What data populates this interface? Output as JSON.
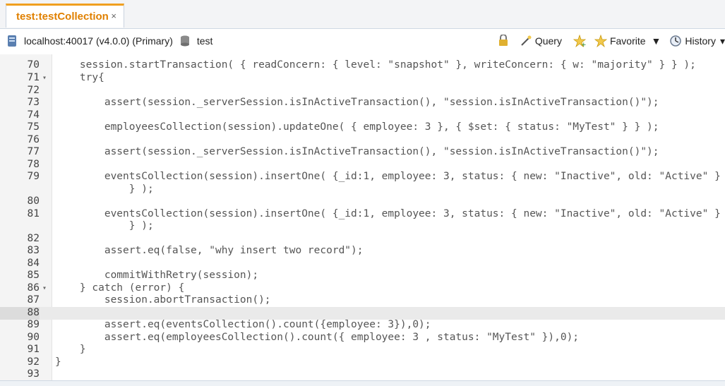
{
  "tab": {
    "title": "test:testCollection",
    "close": "×"
  },
  "toolbar": {
    "connection": "localhost:40017 (v4.0.0) (Primary)",
    "database": "test",
    "query_label": "Query",
    "favorite_label": "Favorite",
    "history_label": "History"
  },
  "editor": {
    "highlighted_line": "88",
    "lines": [
      {
        "n": "70",
        "fold": "",
        "code": "    session.startTransaction( { readConcern: { level: \"snapshot\" }, writeConcern: { w: \"majority\" } } );"
      },
      {
        "n": "71",
        "fold": "▾",
        "code": "    try{"
      },
      {
        "n": "72",
        "fold": "",
        "code": ""
      },
      {
        "n": "73",
        "fold": "",
        "code": "        assert(session._serverSession.isInActiveTransaction(), \"session.isInActiveTransaction()\");"
      },
      {
        "n": "74",
        "fold": "",
        "code": ""
      },
      {
        "n": "75",
        "fold": "",
        "code": "        employeesCollection(session).updateOne( { employee: 3 }, { $set: { status: \"MyTest\" } } );"
      },
      {
        "n": "76",
        "fold": "",
        "code": ""
      },
      {
        "n": "77",
        "fold": "",
        "code": "        assert(session._serverSession.isInActiveTransaction(), \"session.isInActiveTransaction()\");"
      },
      {
        "n": "78",
        "fold": "",
        "code": ""
      },
      {
        "n": "79",
        "fold": "",
        "code": "        eventsCollection(session).insertOne( {_id:1, employee: 3, status: { new: \"Inactive\", old: \"Active\" }"
      },
      {
        "n": "",
        "fold": "",
        "code": "            } );"
      },
      {
        "n": "80",
        "fold": "",
        "code": ""
      },
      {
        "n": "81",
        "fold": "",
        "code": "        eventsCollection(session).insertOne( {_id:1, employee: 3, status: { new: \"Inactive\", old: \"Active\" }"
      },
      {
        "n": "",
        "fold": "",
        "code": "            } );"
      },
      {
        "n": "82",
        "fold": "",
        "code": ""
      },
      {
        "n": "83",
        "fold": "",
        "code": "        assert.eq(false, \"why insert two record\");"
      },
      {
        "n": "84",
        "fold": "",
        "code": ""
      },
      {
        "n": "85",
        "fold": "",
        "code": "        commitWithRetry(session);"
      },
      {
        "n": "86",
        "fold": "▾",
        "code": "    } catch (error) {"
      },
      {
        "n": "87",
        "fold": "",
        "code": "        session.abortTransaction();"
      },
      {
        "n": "88",
        "fold": "",
        "code": ""
      },
      {
        "n": "89",
        "fold": "",
        "code": "        assert.eq(eventsCollection().count({employee: 3}),0);"
      },
      {
        "n": "90",
        "fold": "",
        "code": "        assert.eq(employeesCollection().count({ employee: 3 , status: \"MyTest\" }),0);"
      },
      {
        "n": "91",
        "fold": "",
        "code": "    }"
      },
      {
        "n": "92",
        "fold": "",
        "code": "}"
      },
      {
        "n": "93",
        "fold": "",
        "code": ""
      }
    ]
  }
}
